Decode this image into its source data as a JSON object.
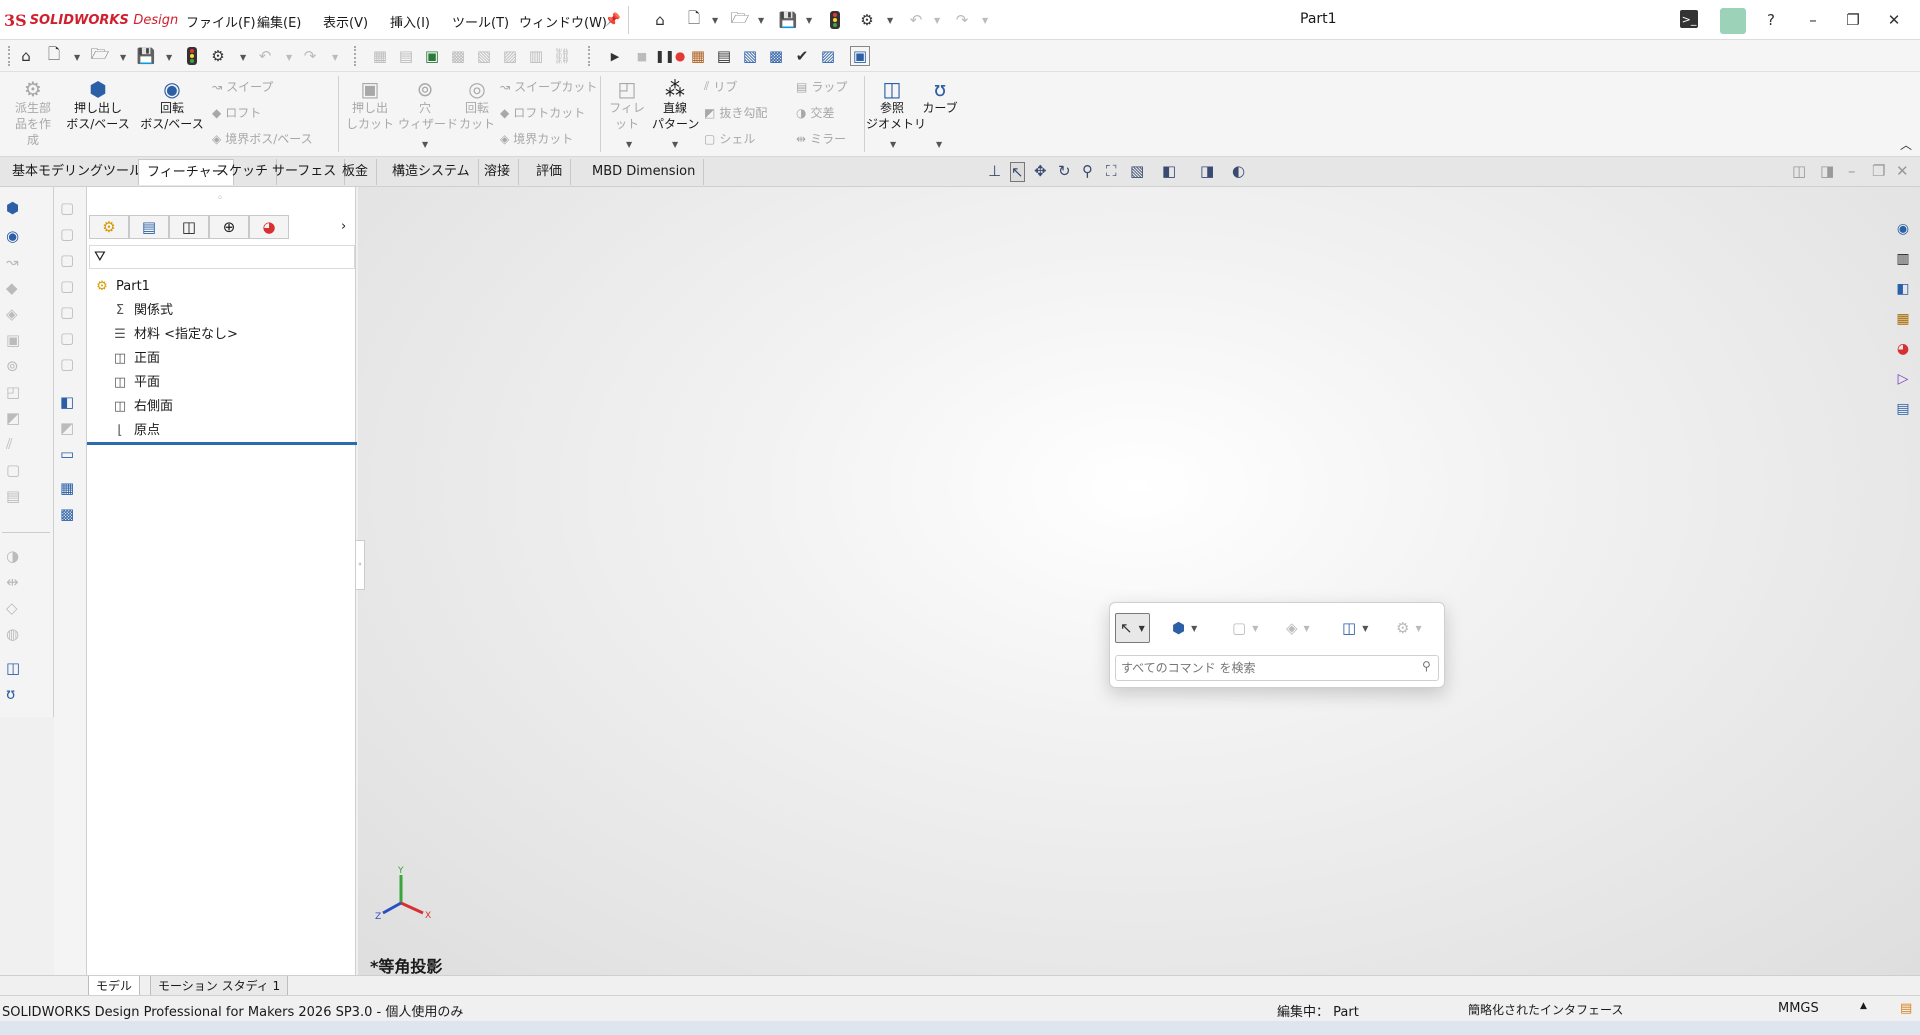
{
  "app": {
    "brand_mark": "3S",
    "brand": "SOLIDWORKS",
    "brand_suffix": "Design",
    "doc_title": "Part1"
  },
  "menu": [
    {
      "label": "ファイル(F)"
    },
    {
      "label": "編集(E)"
    },
    {
      "label": "表示(V)"
    },
    {
      "label": "挿入(I)"
    },
    {
      "label": "ツール(T)"
    },
    {
      "label": "ウィンドウ(W)"
    }
  ],
  "commands": {
    "derived_part": "派生部\n品を作\n成",
    "extrude_boss": "押し出し\nボス/ベース",
    "revolve_boss": "回転\nボス/ベース",
    "sweep": "スイープ",
    "loft": "ロフト",
    "boundary_boss": "境界ボス/ベース",
    "extrude_cut": "押し出\nしカット",
    "hole_wizard": "穴\nウィザード",
    "revolve_cut": "回転\nカット",
    "sweep_cut": "スイープカット",
    "loft_cut": "ロフトカット",
    "boundary_cut": "境界カット",
    "fillet": "フィレット",
    "linear_pattern": "直線\nパターン",
    "rib": "リブ",
    "draft": "抜き勾配",
    "shell": "シェル",
    "wrap": "ラップ",
    "intersect": "交差",
    "mirror": "ミラー",
    "ref_geometry": "参照\nジオメトリ",
    "curves": "カーブ"
  },
  "tabs": [
    {
      "label": "基本モデリングツール",
      "active": false
    },
    {
      "label": "フィーチャー",
      "active": true
    },
    {
      "label": "スケッチ",
      "active": false
    },
    {
      "label": "サーフェス",
      "active": false
    },
    {
      "label": "板金",
      "active": false
    },
    {
      "label": "構造システム",
      "active": false
    },
    {
      "label": "溶接",
      "active": false
    },
    {
      "label": "評価",
      "active": false
    },
    {
      "label": "MBD Dimension",
      "active": false
    }
  ],
  "tree": {
    "root": "Part1",
    "items": [
      {
        "label": "関係式",
        "icon": "equations-icon"
      },
      {
        "label": "材料 <指定なし>",
        "icon": "material-icon"
      },
      {
        "label": "正面",
        "icon": "plane-icon"
      },
      {
        "label": "平面",
        "icon": "plane-icon"
      },
      {
        "label": "右側面",
        "icon": "plane-icon"
      },
      {
        "label": "原点",
        "icon": "origin-icon"
      }
    ]
  },
  "viewport": {
    "view_label": "*等角投影",
    "axis_x": "X",
    "axis_y": "Y",
    "axis_z": "Z"
  },
  "popup": {
    "search_placeholder": "すべてのコマンド を検索"
  },
  "bottom_tabs": [
    {
      "label": "モデル",
      "active": true
    },
    {
      "label": "モーション スタディ 1",
      "active": false
    }
  ],
  "status": {
    "product": "SOLIDWORKS Design Professional for Makers 2026 SP3.0 - 個人使用のみ",
    "editing": "編集中： Part",
    "interface": "簡略化されたインタフェース",
    "units": "MMGS"
  },
  "colors": {
    "brand_red": "#d0202e",
    "selection_blue": "#2b6cb0",
    "icon_blue": "#2b5fa6"
  }
}
